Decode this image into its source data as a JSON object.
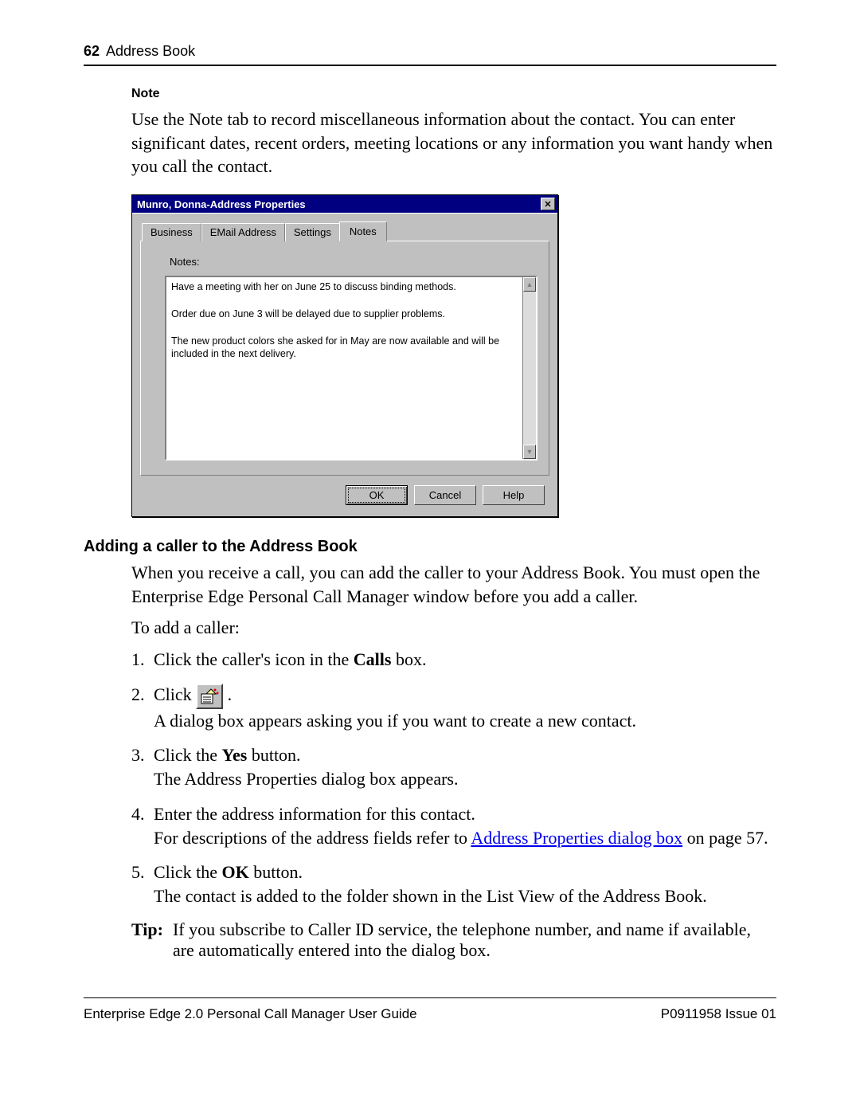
{
  "header": {
    "page_number": "62",
    "chapter": "Address Book"
  },
  "note": {
    "label": "Note",
    "body": "Use the Note tab to record miscellaneous information about the contact. You can enter significant dates, recent orders, meeting locations or any information you want handy when you call the contact."
  },
  "dialog": {
    "title": "Munro, Donna-Address Properties",
    "tabs": [
      "Business",
      "EMail Address",
      "Settings",
      "Notes"
    ],
    "active_tab": 3,
    "notes_label": "Notes:",
    "notes_text": "Have a meeting with her on June 25 to discuss binding methods.\n\nOrder due on June 3 will be delayed due to supplier problems.\n\nThe new product colors she asked for in May are now available and will be included in the next delivery.",
    "buttons": {
      "ok": "OK",
      "cancel": "Cancel",
      "help": "Help"
    }
  },
  "section": {
    "heading": "Adding a caller to the Address Book",
    "intro": "When you receive a call, you can add the caller to your Address Book. You must open the Enterprise Edge Personal Call Manager window before you add a caller.",
    "lead": "To add a caller:",
    "steps": {
      "s1_a": "Click the caller's icon in the ",
      "s1_b": "Calls",
      "s1_c": " box.",
      "s2_a": "Click ",
      "s2_b": ".",
      "s2_line2": "A dialog box appears asking you if you want to create a new contact.",
      "s3_a": "Click the ",
      "s3_b": "Yes",
      "s3_c": " button.",
      "s3_line2": "The Address Properties dialog box appears.",
      "s4_a": "Enter the address information for this contact.",
      "s4_b": "For descriptions of the address fields refer to ",
      "s4_link": "Address Properties dialog box",
      "s4_c": " on page 57.",
      "s5_a": "Click the ",
      "s5_b": "OK",
      "s5_c": " button.",
      "s5_line2": "The contact is added to the folder shown in the List View of the Address Book."
    },
    "tip_label": "Tip:",
    "tip_body": "If you subscribe to Caller ID service, the telephone number, and name if available, are automatically entered into the dialog box."
  },
  "footer": {
    "left": "Enterprise Edge 2.0 Personal Call Manager User Guide",
    "right": "P0911958 Issue 01"
  }
}
